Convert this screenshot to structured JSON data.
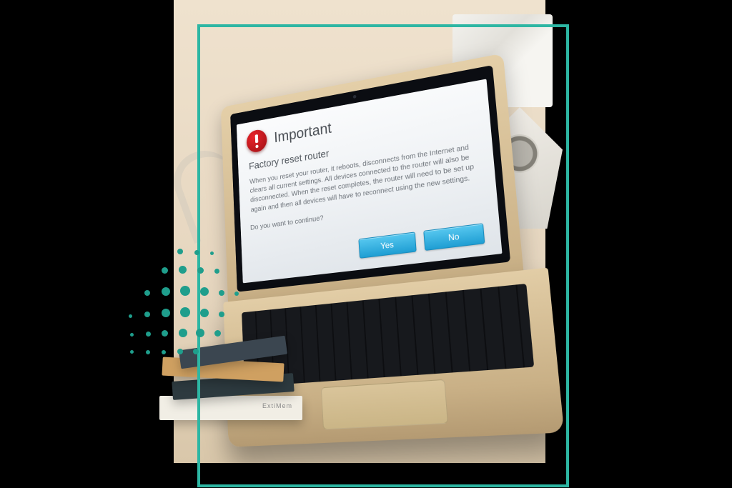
{
  "colors": {
    "accent": "#2db6a3",
    "button": "#2aa9da",
    "alert": "#c51a20"
  },
  "dialog": {
    "icon": "alert-icon",
    "title": "Important",
    "subtitle": "Factory reset router",
    "body": "When you reset your router, it reboots, disconnects from the Internet and clears all current settings. All devices connected to the router will also be disconnected. When the reset completes, the router will need to be set up again and then all devices will have to reconnect using the new settings.",
    "prompt": "Do you want to continue?",
    "buttons": {
      "yes": "Yes",
      "no": "No"
    }
  }
}
